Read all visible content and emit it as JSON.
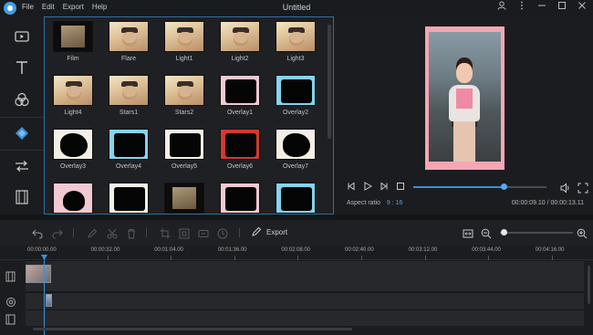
{
  "app": {
    "title": "Untitled",
    "menu": [
      "File",
      "Edit",
      "Export",
      "Help"
    ],
    "window_controls": [
      "user-icon",
      "more-icon",
      "minimize-icon",
      "maximize-icon",
      "close-icon"
    ]
  },
  "sidebar": {
    "items": [
      {
        "name": "media",
        "icon": "video-icon"
      },
      {
        "name": "text",
        "icon": "text-icon"
      },
      {
        "name": "filters",
        "icon": "filters-icon"
      },
      {
        "name": "overlays",
        "icon": "overlay-icon",
        "active": true
      },
      {
        "name": "transitions",
        "icon": "transition-icon"
      },
      {
        "name": "film",
        "icon": "film-icon"
      }
    ],
    "accent": "#3d8fd6"
  },
  "effects": {
    "items": [
      {
        "label": "Film",
        "style": "dark"
      },
      {
        "label": "Flare",
        "style": "dog"
      },
      {
        "label": "Light1",
        "style": "dog"
      },
      {
        "label": "Light2",
        "style": "dog"
      },
      {
        "label": "Light3",
        "style": "dog"
      },
      {
        "label": "Light4",
        "style": "dog"
      },
      {
        "label": "Stars1",
        "style": "dog"
      },
      {
        "label": "Stars2",
        "style": "dog"
      },
      {
        "label": "Overlay1",
        "style": "pink"
      },
      {
        "label": "Overlay2",
        "style": "cyan"
      },
      {
        "label": "Overlay3",
        "style": "blob"
      },
      {
        "label": "Overlay4",
        "style": "cyan"
      },
      {
        "label": "Overlay5",
        "style": "white"
      },
      {
        "label": "Overlay6",
        "style": "red"
      },
      {
        "label": "Overlay7",
        "style": "blob"
      },
      {
        "label": "",
        "style": "heart"
      },
      {
        "label": "",
        "style": "white"
      },
      {
        "label": "",
        "style": "dark"
      },
      {
        "label": "",
        "style": "pink"
      },
      {
        "label": "",
        "style": "cyan"
      }
    ]
  },
  "preview": {
    "aspect_label": "Aspect ratio",
    "aspect_value": "9 : 16",
    "time_display": "00:00:09.10 / 00:00:13.11",
    "progress": 0.68
  },
  "toolbar": {
    "export_label": "Export",
    "zoom_level": 0.05
  },
  "timeline": {
    "ticks": [
      "00:00:00.00",
      "00:00:32.00",
      "00:01:04.00",
      "00:01:36.00",
      "00:02:08.00",
      "00:02:40.00",
      "00:03:12.00",
      "00:03:44.00",
      "00:04:16.00"
    ]
  }
}
